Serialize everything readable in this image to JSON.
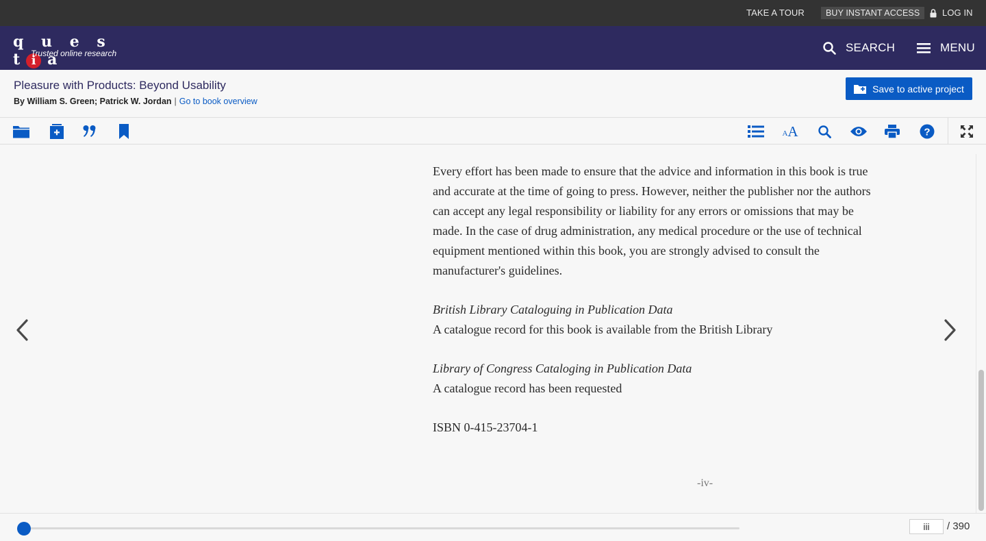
{
  "utility_bar": {
    "take_tour": "TAKE A TOUR",
    "buy_access": "BUY INSTANT ACCESS",
    "log_in": "LOG IN"
  },
  "brand": {
    "logo_word": "questia",
    "tagline": "Trusted online research",
    "search_label": "SEARCH",
    "menu_label": "MENU"
  },
  "book": {
    "title": "Pleasure with Products: Beyond Usability",
    "by_prefix": "By",
    "authors": "William S. Green; Patrick W. Jordan",
    "separator": "|",
    "overview_link": "Go to book overview",
    "save_button": "Save to active project"
  },
  "toolbar": {
    "left_icons": [
      "folder-icon",
      "add-note-icon",
      "quote-icon",
      "bookmark-icon"
    ],
    "right_icons": [
      "table-of-contents-icon",
      "font-size-icon",
      "search-icon",
      "view-icon",
      "print-icon",
      "help-icon",
      "fullscreen-icon"
    ],
    "font_size_small": "A",
    "font_size_large": "A"
  },
  "page": {
    "p1": "Every effort has been made to ensure that the advice and information in this book is true and accurate at the time of going to press. However, neither the publisher nor the authors can accept any legal responsibility or liability for any errors or omissions that may be made. In the case of drug administration, any medical procedure or the use of technical equipment mentioned within this book, you are strongly advised to consult the manufacturer's guidelines.",
    "bl_heading": "British Library Cataloguing in Publication Data",
    "bl_text": "A catalogue record for this book is available from the British Library",
    "loc_heading": "Library of Congress Cataloging in Publication Data",
    "loc_text": "A catalogue record has been requested",
    "isbn": "ISBN 0-415-23704-1",
    "folio": "-iv-"
  },
  "pagination": {
    "current_page": "iii",
    "total": "/ 390",
    "progress_fraction": 0.0
  },
  "colors": {
    "utility_bg": "#333333",
    "brand_bg": "#2e2a5f",
    "accent_blue": "#0a5bc4",
    "logo_red": "#d41f2b"
  }
}
